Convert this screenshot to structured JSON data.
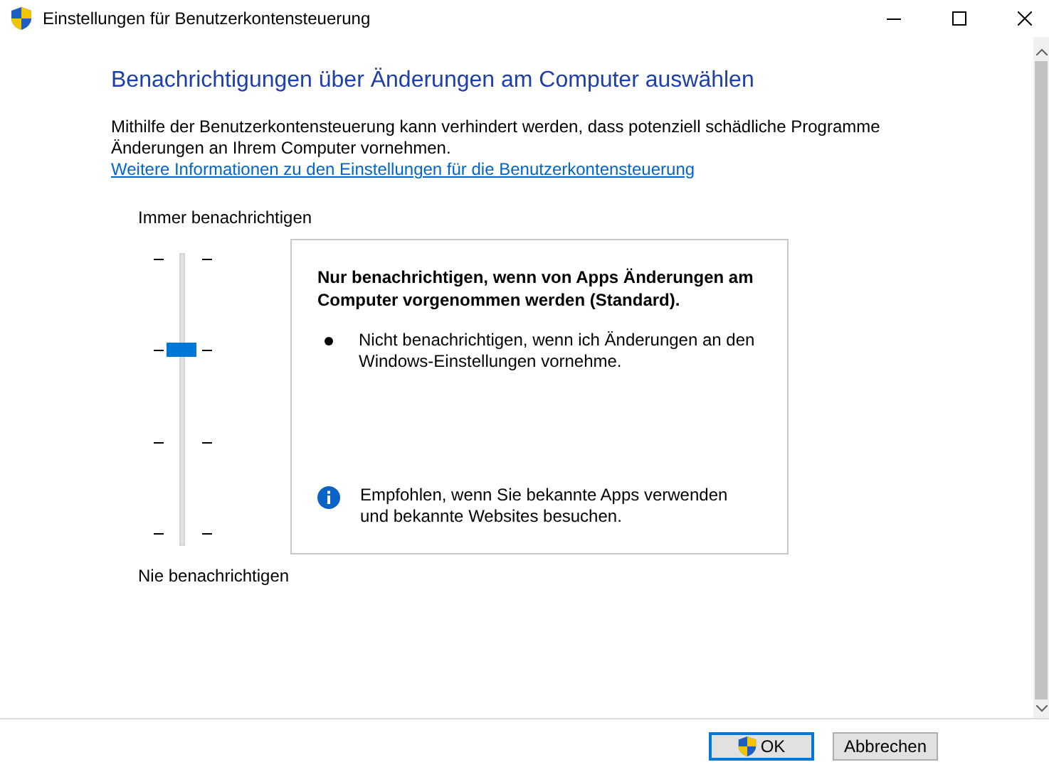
{
  "window": {
    "title": "Einstellungen für Benutzerkontensteuerung"
  },
  "heading": "Benachrichtigungen über Änderungen am Computer auswählen",
  "description": "Mithilfe der Benutzerkontensteuerung kann verhindert werden, dass potenziell schädliche Programme Änderungen an Ihrem Computer vornehmen.",
  "link": "Weitere Informationen zu den Einstellungen für die Benutzerkontensteuerung",
  "slider": {
    "top_label": "Immer benachrichtigen",
    "bottom_label": "Nie benachrichtigen",
    "level": 0.67
  },
  "info_panel": {
    "title": "Nur benachrichtigen, wenn von Apps Änderungen am Computer vorgenommen werden (Standard).",
    "bullets": [
      "Nicht benachrichtigen, wenn ich Änderungen an den Windows-Einstellungen vornehme."
    ],
    "recommendation": "Empfohlen, wenn Sie bekannte Apps verwenden und bekannte Websites besuchen."
  },
  "buttons": [
    {
      "label": "OK",
      "kind": "shield",
      "default": true
    },
    {
      "label": "Abbrechen",
      "kind": "plain",
      "default": false
    }
  ]
}
